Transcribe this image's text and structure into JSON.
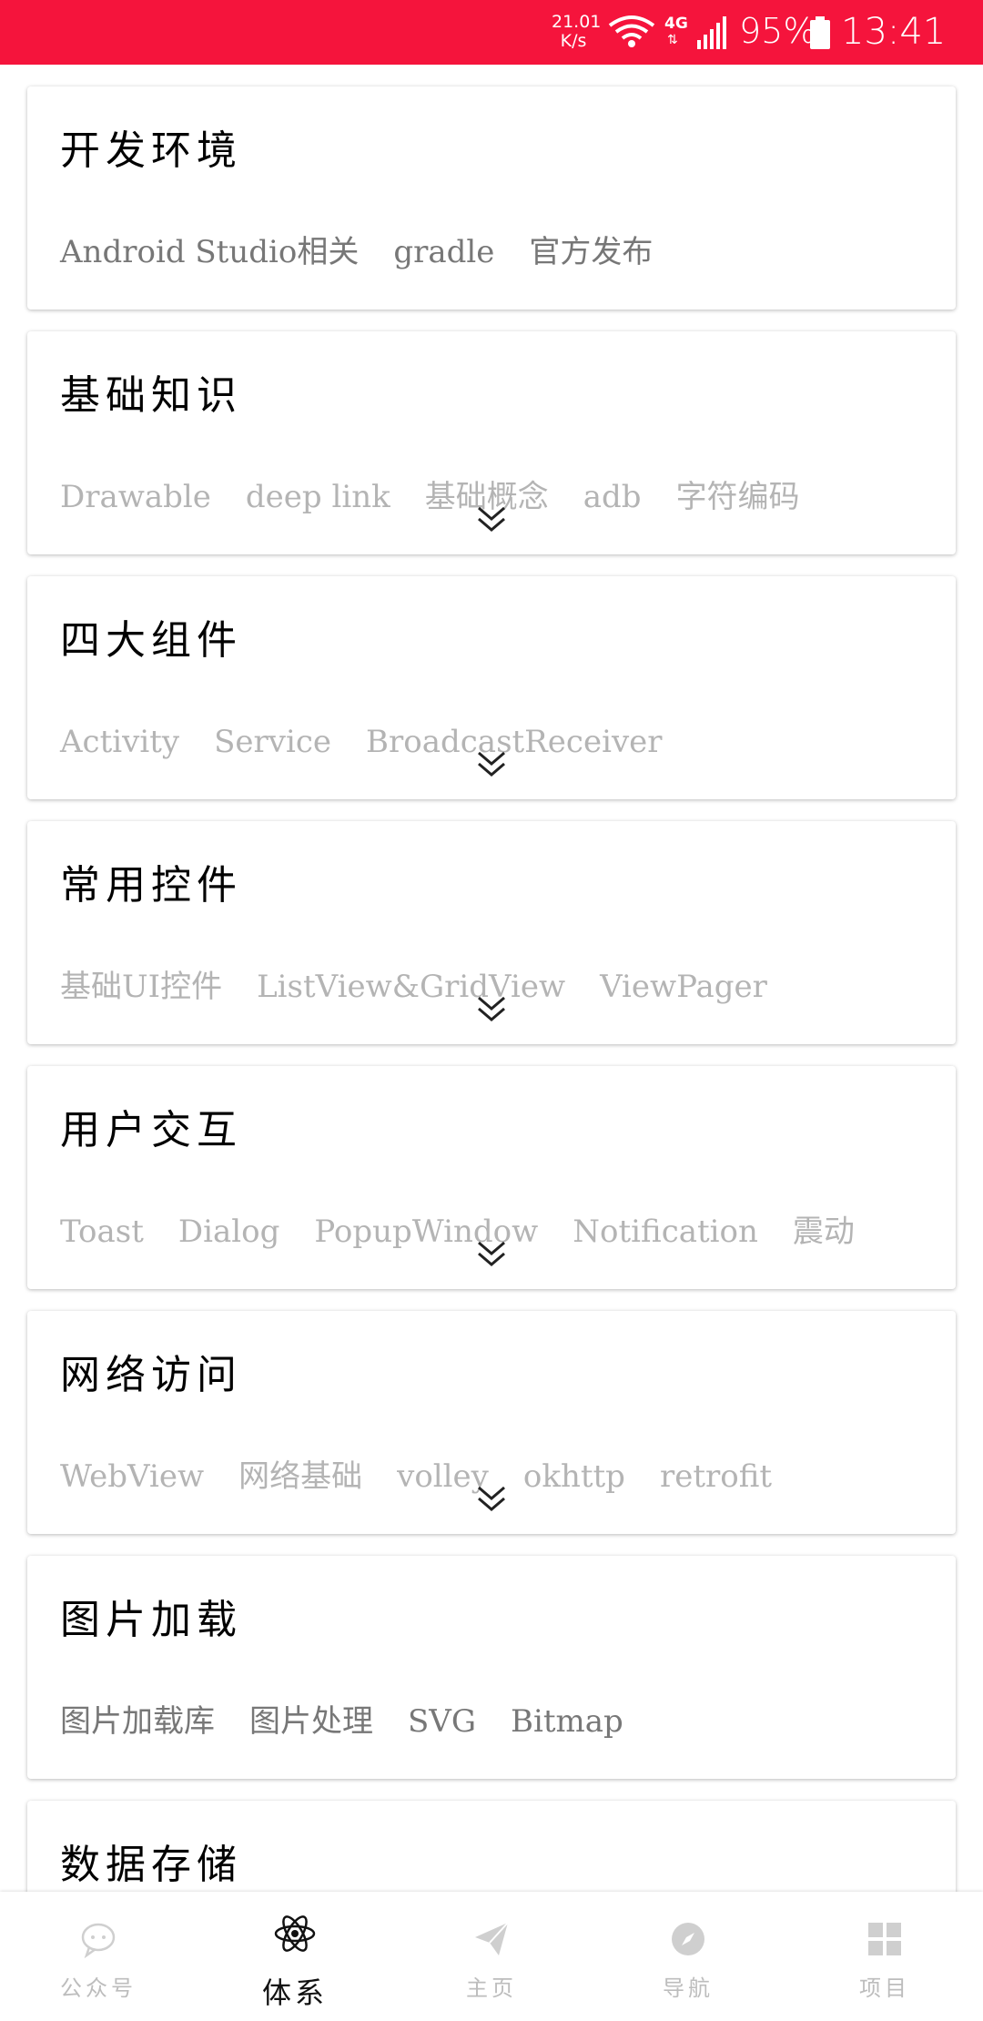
{
  "status_bar": {
    "net_speed_value": "21.01",
    "net_speed_unit": "K/s",
    "network_type": "4G",
    "battery_percent": "95%",
    "time": "13:41",
    "background_color": "#f5143c"
  },
  "categories": [
    {
      "title": "开发环境",
      "tags": [
        "Android Studio相关",
        "gradle",
        "官方发布"
      ]
    },
    {
      "title": "基础知识",
      "tags": [
        "Drawable",
        "deep link",
        "基础概念",
        "adb",
        "字符编码"
      ]
    },
    {
      "title": "四大组件",
      "tags": [
        "Activity",
        "Service",
        "BroadcastReceiver"
      ]
    },
    {
      "title": "常用控件",
      "tags": [
        "基础UI控件",
        "ListView&GridView",
        "ViewPager"
      ]
    },
    {
      "title": "用户交互",
      "tags": [
        "Toast",
        "Dialog",
        "PopupWindow",
        "Notification",
        "震动"
      ]
    },
    {
      "title": "网络访问",
      "tags": [
        "WebView",
        "网络基础",
        "volley",
        "okhttp",
        "retrofit"
      ]
    },
    {
      "title": "图片加载",
      "tags": [
        "图片加载库",
        "图片处理",
        "SVG",
        "Bitmap"
      ]
    },
    {
      "title": "数据存储",
      "tags": []
    }
  ],
  "bottom_nav": {
    "items": [
      {
        "label": "公众号",
        "icon": "chat-bubble-icon",
        "active": false
      },
      {
        "label": "体系",
        "icon": "atom-icon",
        "active": true
      },
      {
        "label": "主页",
        "icon": "paper-plane-icon",
        "active": false
      },
      {
        "label": "导航",
        "icon": "compass-icon",
        "active": false
      },
      {
        "label": "项目",
        "icon": "grid-icon",
        "active": false
      }
    ]
  }
}
